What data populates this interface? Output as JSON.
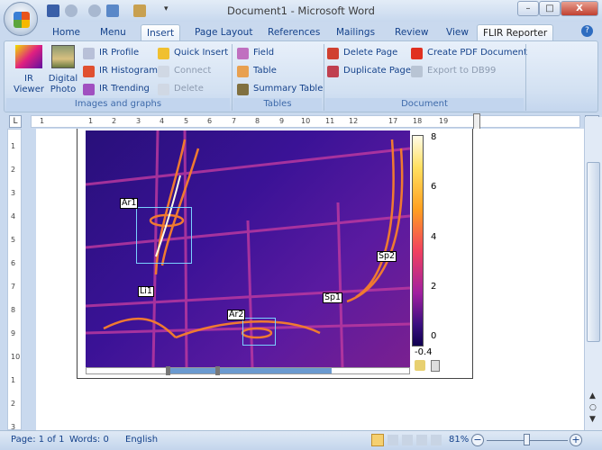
{
  "window": {
    "title": "Document1 - Microsoft Word",
    "minimize": "–",
    "maximize": "□",
    "close": "X"
  },
  "quick_access": [
    {
      "icon": "save-icon"
    },
    {
      "icon": "undo-icon"
    },
    {
      "icon": "redo-icon"
    },
    {
      "icon": "paste-icon"
    },
    {
      "icon": "stamp-icon"
    },
    {
      "icon": "customize-icon"
    }
  ],
  "tabs": [
    {
      "label": "Home"
    },
    {
      "label": "Menu"
    },
    {
      "label": "Insert",
      "active": true
    },
    {
      "label": "Page Layout"
    },
    {
      "label": "References"
    },
    {
      "label": "Mailings"
    },
    {
      "label": "Review"
    },
    {
      "label": "View"
    },
    {
      "label": "FLIR Reporter"
    }
  ],
  "ribbon": {
    "groups": [
      {
        "label": "Images and graphs",
        "big": [
          {
            "label": "IR Viewer",
            "l1": "IR",
            "l2": "Viewer"
          },
          {
            "label": "Digital Photo",
            "l1": "Digital",
            "l2": "Photo"
          }
        ],
        "items": [
          {
            "label": "IR Profile"
          },
          {
            "label": "IR Histogram"
          },
          {
            "label": "IR Trending"
          },
          {
            "label": "Quick Insert"
          },
          {
            "label": "Connect",
            "disabled": true
          },
          {
            "label": "Delete",
            "disabled": true
          }
        ]
      },
      {
        "label": "Tables",
        "items": [
          {
            "label": "Field"
          },
          {
            "label": "Table"
          },
          {
            "label": "Summary Table"
          }
        ]
      },
      {
        "label": "Document",
        "items": [
          {
            "label": "Delete Page"
          },
          {
            "label": "Duplicate Page"
          },
          {
            "label": "Create PDF Document"
          },
          {
            "label": "Export to DB99",
            "disabled": true
          }
        ]
      }
    ]
  },
  "ruler": {
    "numbers": [
      "1",
      "1",
      "2",
      "3",
      "4",
      "5",
      "6",
      "7",
      "8",
      "9",
      "10",
      "11",
      "12",
      "17",
      "18",
      "19"
    ],
    "vnumbers": [
      "1",
      "2",
      "3",
      "4",
      "5",
      "6",
      "7",
      "8",
      "9",
      "10",
      "1",
      "2",
      "3"
    ]
  },
  "thermal_image": {
    "scale_labels": [
      "8",
      "6",
      "4",
      "2",
      "0",
      "-0.4"
    ],
    "overlays": [
      {
        "label": "Ar1"
      },
      {
        "label": "Li1"
      },
      {
        "label": "Sp2"
      },
      {
        "label": "Sp1"
      },
      {
        "label": "Ar2"
      }
    ]
  },
  "status": {
    "page": "Page: 1 of 1",
    "words": "Words: 0",
    "language": "English",
    "zoom": "81%"
  },
  "colors": {
    "ribbon": "#d3e1f2",
    "accent": "#15428b"
  }
}
